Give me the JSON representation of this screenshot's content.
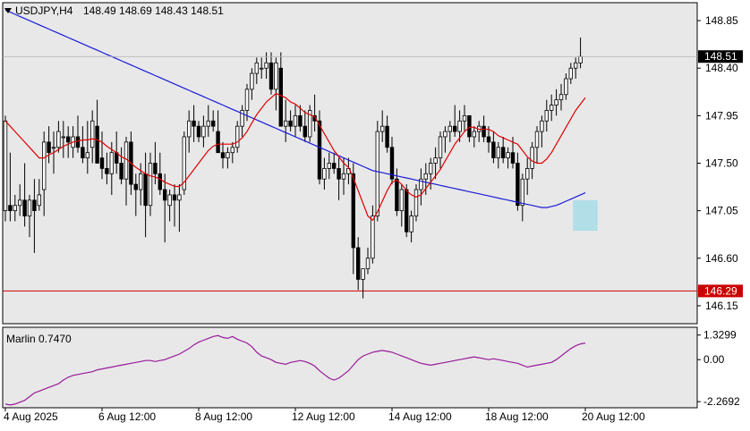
{
  "header": {
    "symbol": "USDJPY,H4",
    "ohlc": "148.49 148.69 148.43 148.51"
  },
  "oscillator": {
    "label": "Marlin 0.7470"
  },
  "colors": {
    "background": "#ffffff",
    "plot_bg": "#e8e8e8",
    "axis": "#000000",
    "ma_fast": "#e00000",
    "ma_slow": "#1a1ad8",
    "level_line": "#cc0000",
    "oscillator": "#9a1a9a",
    "highlight_box": "#a8dce8",
    "price_label_bg": "#000000",
    "level_label_bg": "#cc0000"
  },
  "chart_data": [
    {
      "type": "candlestick",
      "title": "USDJPY,H4",
      "y_ticks": [
        "148.85",
        "148.40",
        "147.95",
        "147.50",
        "147.05",
        "146.60",
        "146.15"
      ],
      "ylim": [
        145.98,
        149.02
      ],
      "x_ticks": [
        "4 Aug 2025",
        "6 Aug 12:00",
        "8 Aug 12:00",
        "12 Aug 12:00",
        "14 Aug 12:00",
        "18 Aug 12:00",
        "20 Aug 12:00"
      ],
      "x_tick_index": [
        0,
        20,
        40,
        60,
        80,
        100,
        120
      ],
      "current_price": "148.51",
      "level_line": {
        "value": 146.29,
        "label": "146.29"
      },
      "highlight_box": {
        "from_index": 118,
        "to_index": 122,
        "low": 146.86,
        "high": 147.15
      },
      "candles": [
        [
          147.05,
          147.95,
          146.95,
          147.9
        ],
        [
          147.1,
          147.6,
          146.95,
          147.05
        ],
        [
          147.05,
          147.2,
          146.95,
          147.1
        ],
        [
          147.1,
          147.3,
          147.0,
          147.15
        ],
        [
          147.15,
          147.5,
          146.9,
          147.0
        ],
        [
          147.0,
          147.2,
          146.8,
          147.15
        ],
        [
          147.15,
          147.35,
          146.65,
          147.05
        ],
        [
          147.1,
          147.35,
          147.05,
          147.2
        ],
        [
          147.25,
          147.8,
          147.0,
          147.7
        ],
        [
          147.7,
          147.85,
          147.5,
          147.6
        ],
        [
          147.65,
          147.8,
          147.4,
          147.65
        ],
        [
          147.65,
          147.9,
          147.6,
          147.8
        ],
        [
          147.75,
          147.9,
          147.55,
          147.75
        ],
        [
          147.75,
          147.85,
          147.55,
          147.7
        ],
        [
          147.65,
          147.85,
          147.55,
          147.75
        ],
        [
          147.75,
          147.95,
          147.6,
          147.65
        ],
        [
          147.65,
          147.85,
          147.5,
          147.55
        ],
        [
          147.55,
          147.9,
          147.4,
          147.6
        ],
        [
          147.65,
          148.0,
          147.5,
          147.9
        ],
        [
          147.85,
          148.1,
          147.6,
          147.5
        ],
        [
          147.55,
          147.8,
          147.35,
          147.45
        ],
        [
          147.45,
          147.6,
          147.3,
          147.4
        ],
        [
          147.4,
          147.7,
          147.2,
          147.6
        ],
        [
          147.6,
          147.8,
          147.4,
          147.5
        ],
        [
          147.5,
          147.65,
          147.3,
          147.35
        ],
        [
          147.35,
          147.75,
          147.1,
          147.7
        ],
        [
          147.7,
          147.8,
          147.2,
          147.3
        ],
        [
          147.3,
          147.4,
          147.0,
          147.25
        ],
        [
          147.25,
          147.5,
          147.1,
          147.4
        ],
        [
          147.4,
          147.6,
          146.8,
          147.1
        ],
        [
          147.1,
          147.6,
          147.0,
          147.5
        ],
        [
          147.5,
          147.7,
          147.3,
          147.4
        ],
        [
          147.4,
          147.6,
          147.2,
          147.25
        ],
        [
          147.25,
          147.4,
          146.75,
          147.15
        ],
        [
          147.1,
          147.25,
          146.95,
          147.2
        ],
        [
          147.2,
          147.3,
          146.9,
          147.15
        ],
        [
          147.15,
          147.3,
          146.85,
          147.2
        ],
        [
          147.25,
          147.8,
          147.2,
          147.75
        ],
        [
          147.75,
          148.0,
          147.6,
          147.9
        ],
        [
          147.9,
          148.05,
          147.7,
          147.85
        ],
        [
          147.85,
          147.9,
          147.7,
          147.75
        ],
        [
          147.75,
          147.95,
          147.65,
          147.85
        ],
        [
          147.85,
          148.05,
          147.75,
          147.9
        ],
        [
          147.9,
          148.0,
          147.8,
          147.85
        ],
        [
          147.8,
          148.0,
          147.6,
          147.6
        ],
        [
          147.6,
          147.7,
          147.45,
          147.55
        ],
        [
          147.55,
          147.65,
          147.45,
          147.6
        ],
        [
          147.6,
          147.7,
          147.5,
          147.65
        ],
        [
          147.65,
          147.9,
          147.6,
          147.85
        ],
        [
          147.85,
          148.05,
          147.75,
          148.0
        ],
        [
          148.0,
          148.25,
          147.9,
          148.2
        ],
        [
          148.2,
          148.4,
          148.1,
          148.35
        ],
        [
          148.35,
          148.5,
          148.25,
          148.45
        ],
        [
          148.4,
          148.5,
          148.3,
          148.4
        ],
        [
          148.4,
          148.55,
          148.3,
          148.45
        ],
        [
          148.45,
          148.55,
          148.15,
          148.2
        ],
        [
          148.2,
          148.5,
          148.0,
          148.45
        ],
        [
          148.4,
          148.55,
          147.95,
          147.85
        ],
        [
          147.85,
          148.1,
          147.7,
          147.9
        ],
        [
          147.9,
          148.0,
          147.8,
          147.85
        ],
        [
          147.85,
          148.05,
          147.75,
          147.95
        ],
        [
          147.95,
          148.05,
          147.8,
          147.85
        ],
        [
          147.85,
          148.0,
          147.7,
          147.75
        ],
        [
          147.75,
          148.05,
          147.7,
          148.0
        ],
        [
          147.95,
          148.15,
          147.8,
          147.9
        ],
        [
          147.9,
          148.0,
          147.3,
          147.35
        ],
        [
          147.35,
          147.55,
          147.25,
          147.45
        ],
        [
          147.45,
          147.6,
          147.35,
          147.5
        ],
        [
          147.5,
          147.6,
          147.4,
          147.45
        ],
        [
          147.45,
          147.55,
          147.15,
          147.35
        ],
        [
          147.35,
          147.55,
          147.2,
          147.4
        ],
        [
          147.4,
          147.55,
          147.3,
          147.45
        ],
        [
          147.4,
          147.5,
          146.45,
          146.7
        ],
        [
          146.7,
          146.8,
          146.3,
          146.4
        ],
        [
          146.4,
          146.5,
          146.22,
          146.5
        ],
        [
          146.5,
          146.7,
          146.45,
          146.6
        ],
        [
          146.6,
          147.1,
          146.55,
          147.0
        ],
        [
          147.0,
          147.9,
          146.95,
          147.8
        ],
        [
          147.8,
          148.0,
          147.7,
          147.85
        ],
        [
          147.85,
          147.95,
          147.6,
          147.65
        ],
        [
          147.65,
          147.75,
          147.3,
          147.35
        ],
        [
          147.35,
          147.45,
          147.0,
          147.05
        ],
        [
          147.05,
          147.3,
          146.9,
          147.25
        ],
        [
          147.25,
          147.3,
          146.8,
          146.85
        ],
        [
          146.85,
          147.05,
          146.75,
          147.0
        ],
        [
          147.0,
          147.3,
          146.95,
          147.25
        ],
        [
          147.25,
          147.45,
          147.1,
          147.35
        ],
        [
          147.35,
          147.5,
          147.2,
          147.4
        ],
        [
          147.4,
          147.55,
          147.25,
          147.5
        ],
        [
          147.5,
          147.65,
          147.35,
          147.55
        ],
        [
          147.55,
          147.8,
          147.45,
          147.75
        ],
        [
          147.75,
          147.85,
          147.6,
          147.8
        ],
        [
          147.8,
          147.9,
          147.7,
          147.85
        ],
        [
          147.85,
          148.05,
          147.75,
          147.8
        ],
        [
          147.8,
          148.0,
          147.7,
          147.9
        ],
        [
          147.9,
          148.05,
          147.8,
          147.95
        ],
        [
          147.95,
          147.95,
          147.7,
          147.75
        ],
        [
          147.75,
          147.85,
          147.65,
          147.8
        ],
        [
          147.8,
          147.9,
          147.7,
          147.85
        ],
        [
          147.85,
          147.95,
          147.7,
          147.75
        ],
        [
          147.75,
          147.85,
          147.6,
          147.7
        ],
        [
          147.7,
          147.8,
          147.5,
          147.55
        ],
        [
          147.55,
          147.7,
          147.45,
          147.65
        ],
        [
          147.65,
          147.75,
          147.5,
          147.55
        ],
        [
          147.55,
          147.65,
          147.45,
          147.6
        ],
        [
          147.6,
          147.75,
          147.45,
          147.5
        ],
        [
          147.5,
          147.6,
          147.05,
          147.1
        ],
        [
          147.1,
          147.4,
          146.95,
          147.35
        ],
        [
          147.35,
          147.55,
          147.2,
          147.45
        ],
        [
          147.45,
          147.7,
          147.35,
          147.65
        ],
        [
          147.65,
          147.85,
          147.5,
          147.8
        ],
        [
          147.8,
          147.95,
          147.65,
          147.9
        ],
        [
          147.9,
          148.1,
          147.8,
          148.0
        ],
        [
          148.0,
          148.15,
          147.9,
          148.05
        ],
        [
          148.05,
          148.2,
          147.95,
          148.1
        ],
        [
          148.1,
          148.25,
          148.0,
          148.15
        ],
        [
          148.15,
          148.35,
          148.1,
          148.3
        ],
        [
          148.3,
          148.45,
          148.25,
          148.4
        ],
        [
          148.4,
          148.5,
          148.3,
          148.45
        ],
        [
          148.45,
          148.69,
          148.4,
          148.51
        ]
      ],
      "ma_fast": [
        147.9,
        147.85,
        147.8,
        147.75,
        147.7,
        147.65,
        147.6,
        147.55,
        147.55,
        147.58,
        147.6,
        147.63,
        147.66,
        147.68,
        147.7,
        147.71,
        147.72,
        147.72,
        147.73,
        147.72,
        147.7,
        147.66,
        147.63,
        147.6,
        147.56,
        147.54,
        147.5,
        147.46,
        147.43,
        147.4,
        147.38,
        147.37,
        147.35,
        147.32,
        147.3,
        147.28,
        147.28,
        147.32,
        147.38,
        147.44,
        147.5,
        147.56,
        147.62,
        147.66,
        147.68,
        147.68,
        147.68,
        147.68,
        147.7,
        147.74,
        147.8,
        147.88,
        147.96,
        148.02,
        148.08,
        148.12,
        148.16,
        148.14,
        148.12,
        148.08,
        148.06,
        148.02,
        147.98,
        147.96,
        147.94,
        147.86,
        147.78,
        147.7,
        147.62,
        147.56,
        147.5,
        147.46,
        147.36,
        147.24,
        147.12,
        147.0,
        146.96,
        147.04,
        147.14,
        147.24,
        147.32,
        147.34,
        147.3,
        147.24,
        147.2,
        147.18,
        147.2,
        147.26,
        147.32,
        147.38,
        147.44,
        147.52,
        147.6,
        147.68,
        147.74,
        147.8,
        147.84,
        147.84,
        147.82,
        147.82,
        147.82,
        147.8,
        147.76,
        147.74,
        147.72,
        147.7,
        147.68,
        147.62,
        147.56,
        147.52,
        147.5,
        147.5,
        147.54,
        147.6,
        147.68,
        147.76,
        147.84,
        147.92,
        148.0,
        148.06,
        148.12
      ],
      "ma_slow": [
        148.95,
        148.93,
        148.91,
        148.89,
        148.87,
        148.85,
        148.83,
        148.81,
        148.79,
        148.77,
        148.75,
        148.73,
        148.71,
        148.69,
        148.67,
        148.65,
        148.63,
        148.61,
        148.59,
        148.57,
        148.55,
        148.53,
        148.51,
        148.49,
        148.47,
        148.45,
        148.43,
        148.41,
        148.39,
        148.37,
        148.35,
        148.33,
        148.31,
        148.29,
        148.27,
        148.25,
        148.23,
        148.21,
        148.19,
        148.17,
        148.15,
        148.13,
        148.11,
        148.09,
        148.07,
        148.05,
        148.03,
        148.01,
        147.99,
        147.97,
        147.95,
        147.93,
        147.91,
        147.89,
        147.87,
        147.85,
        147.83,
        147.81,
        147.79,
        147.77,
        147.75,
        147.73,
        147.71,
        147.69,
        147.67,
        147.65,
        147.63,
        147.61,
        147.59,
        147.57,
        147.55,
        147.53,
        147.51,
        147.49,
        147.47,
        147.45,
        147.43,
        147.42,
        147.41,
        147.4,
        147.39,
        147.38,
        147.37,
        147.36,
        147.35,
        147.34,
        147.33,
        147.32,
        147.31,
        147.3,
        147.29,
        147.28,
        147.27,
        147.26,
        147.25,
        147.24,
        147.23,
        147.22,
        147.21,
        147.2,
        147.19,
        147.18,
        147.17,
        147.16,
        147.15,
        147.14,
        147.13,
        147.12,
        147.11,
        147.1,
        147.09,
        147.08,
        147.08,
        147.09,
        147.1,
        147.12,
        147.14,
        147.16,
        147.18,
        147.2,
        147.22
      ]
    },
    {
      "type": "line",
      "title": "Marlin 0.7470",
      "y_ticks": [
        "1.3299",
        "0.00",
        "-2.2692"
      ],
      "ylim": [
        -2.6,
        1.75
      ],
      "series": [
        {
          "values": [
            -2.4,
            -2.45,
            -2.4,
            -2.3,
            -2.2,
            -2.0,
            -1.8,
            -1.7,
            -1.6,
            -1.5,
            -1.4,
            -1.3,
            -1.1,
            -0.95,
            -0.85,
            -0.8,
            -0.75,
            -0.7,
            -0.65,
            -0.55,
            -0.5,
            -0.45,
            -0.4,
            -0.35,
            -0.3,
            -0.25,
            -0.2,
            -0.15,
            -0.1,
            -0.05,
            -0.05,
            -0.1,
            -0.05,
            0.0,
            0.1,
            0.2,
            0.3,
            0.45,
            0.6,
            0.8,
            0.95,
            1.05,
            1.15,
            1.25,
            1.3,
            1.2,
            1.15,
            1.25,
            1.1,
            1.0,
            0.9,
            0.7,
            0.4,
            0.2,
            0.1,
            0.0,
            -0.15,
            -0.2,
            -0.25,
            -0.15,
            -0.1,
            -0.05,
            -0.1,
            -0.2,
            -0.35,
            -0.6,
            -0.8,
            -1.0,
            -1.1,
            -1.0,
            -0.8,
            -0.6,
            -0.3,
            0.0,
            0.2,
            0.3,
            0.4,
            0.45,
            0.5,
            0.45,
            0.4,
            0.3,
            0.2,
            0.1,
            0.0,
            -0.1,
            -0.2,
            -0.25,
            -0.3,
            -0.25,
            -0.2,
            -0.15,
            -0.1,
            -0.05,
            0.0,
            0.05,
            0.1,
            0.15,
            0.1,
            0.05,
            0.0,
            0.05,
            0.0,
            -0.05,
            -0.1,
            -0.15,
            -0.2,
            -0.3,
            -0.4,
            -0.35,
            -0.3,
            -0.25,
            -0.2,
            -0.15,
            0.0,
            0.2,
            0.4,
            0.6,
            0.75,
            0.85,
            0.9
          ]
        }
      ]
    }
  ]
}
